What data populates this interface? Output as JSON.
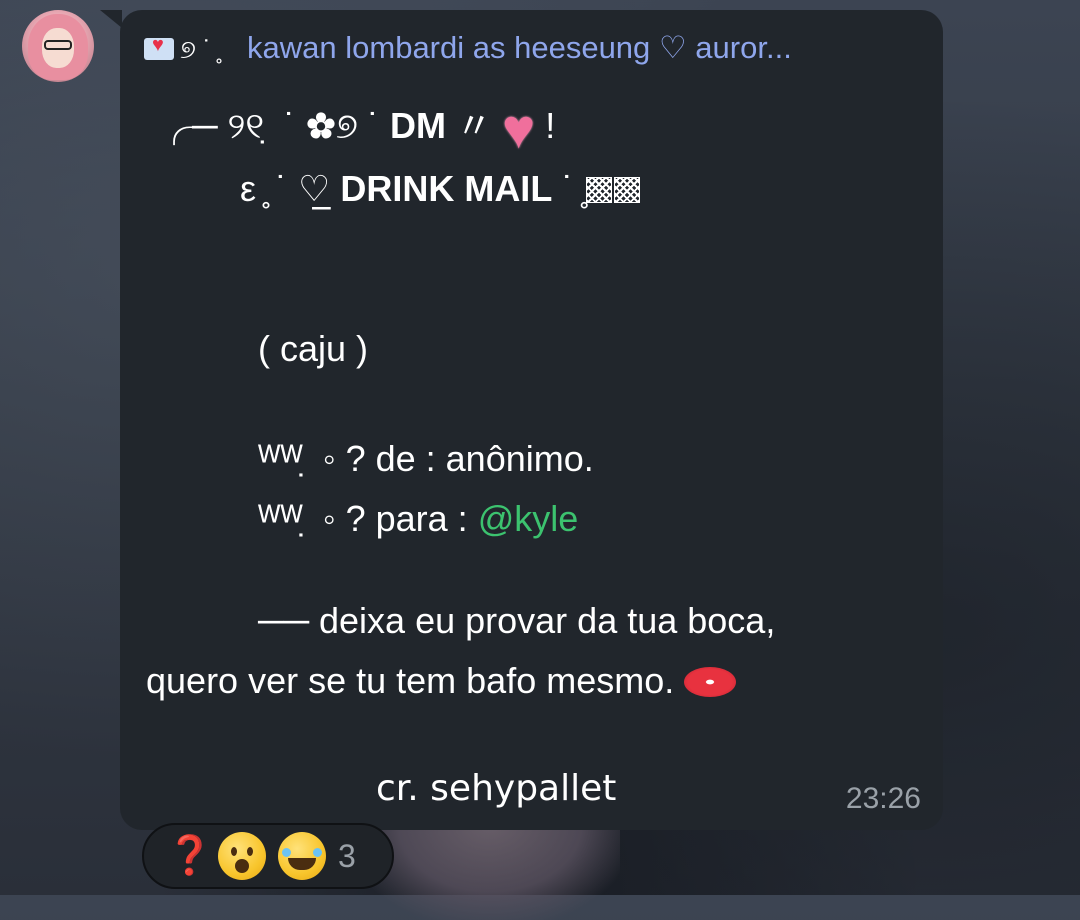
{
  "message": {
    "sender": "kawan lombardi as heeseung ♡ auror...",
    "line1": {
      "prefix": "╭─  ୨୧ ̣ ˙ ✿୭ ˙ ",
      "bold": "DM",
      "suffix_before_heart": "  〃 ",
      "suffix_after_heart": "   !"
    },
    "line2": {
      "prefix": "ε ̥ ˙  ♡̲ ",
      "bold": "DRINK MAIL",
      "suffix": "  ˙   ̥"
    },
    "caju": "(   caju )",
    "from_line": "ᵂᵂ ̣  ◦  ?  de  :  anônimo.",
    "to_line_prefix": "ᵂᵂ ̣  ◦  ?  para  :  ",
    "mention": "@kyle",
    "body_line1": "──  deixa eu provar da tua boca,",
    "body_line2": "quero ver se tu tem bafo mesmo.",
    "credit": "cr. sehypallet",
    "time": "23:26"
  },
  "reactions": {
    "count": "3",
    "items": [
      "question-mark",
      "surprised-face",
      "rolling-laughing-face"
    ]
  },
  "colors": {
    "bubble": "#21262c",
    "sender": "#8fa6ec",
    "mention": "#3cc36f",
    "time": "#9aa1a8"
  }
}
